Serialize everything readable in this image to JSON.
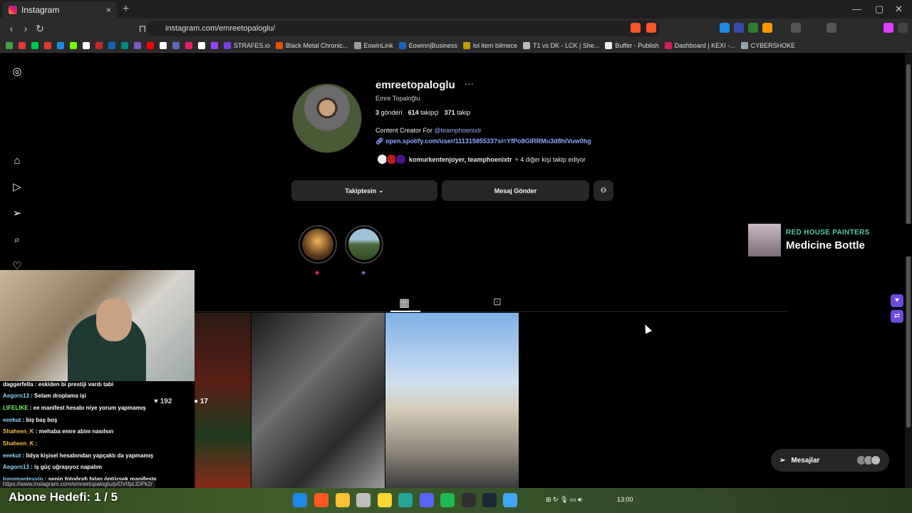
{
  "browser": {
    "tab_title": "Instagram",
    "tab_close": "×",
    "new_tab": "+",
    "url": "instagram.com/emreetopaloglu/",
    "window_controls": [
      "—",
      "▢",
      "✕"
    ],
    "nav_icons": [
      "back-icon",
      "forward-icon",
      "reload-icon"
    ],
    "bookmarks": [
      {
        "label": "STRAFES.io",
        "color": "#7b3fe4"
      },
      {
        "label": "Black Metal Chronic...",
        "color": "#e65100"
      },
      {
        "label": "EowinLink",
        "color": "#9e9e9e"
      },
      {
        "label": "Eowinn|Business",
        "color": "#1565c0"
      },
      {
        "label": "lol item bilmece",
        "color": "#c29d00"
      },
      {
        "label": "T1 vs DK - LCK | She...",
        "color": "#bbbbbb"
      },
      {
        "label": "Buffer - Publish",
        "color": "#eeeeee"
      },
      {
        "label": "Dashboard | KEXI -...",
        "color": "#d81b60"
      },
      {
        "label": "CYBERSHOKE",
        "color": "#90a4ae"
      }
    ],
    "bookmark_icons": [
      "#43a047",
      "#e53935",
      "#00c853",
      "#e53935",
      "#1e88e5",
      "#76ff03",
      "#ffffff",
      "#c62828",
      "#1565c0",
      "#00897b",
      "#7e57c2",
      "#ff0000",
      "#ffffff",
      "#5c6bc0",
      "#e91e63",
      "#ffffff",
      "#9146ff"
    ]
  },
  "sidebar": {
    "icons": [
      "instagram-logo-icon",
      "home-icon",
      "reels-icon",
      "explore-icon",
      "search-icon",
      "notifications-icon"
    ]
  },
  "profile": {
    "username": "emreetopaloglu",
    "more": "···",
    "full_name": "Emre Topaloğlu",
    "posts_count": "3",
    "posts_label": "gönderi",
    "followers_count": "614",
    "followers_label": "takipçi",
    "following_count": "371",
    "following_label": "takip",
    "bio_prefix": "Content Creator For ",
    "bio_mention": "@teamphoenixtr",
    "link": "open.spotify.com/user/11131585533?si=YfPo8GIRRMu3d8hIVuw0hg",
    "followed_by_names": "komurkentenjoyer, teamphoenixtr",
    "followed_by_suffix": " + 4 diğer kişi takip ediyor",
    "follow_button": "Takiptesin",
    "message_button": "Mesaj Gönder",
    "suggest_button_icon": "add-person-icon"
  },
  "highlights": [
    {
      "dot": "◆",
      "dot_color": "#e91e63"
    },
    {
      "dot": "◆",
      "dot_color": "#5c6bc0"
    }
  ],
  "tabs": {
    "posts_icon": "grid-icon",
    "tagged_icon": "tagged-icon"
  },
  "post_overlay": {
    "likes": "192",
    "comments": "17"
  },
  "stream": {
    "chat": [
      {
        "nick": "daggerfella",
        "nick_color": "#ffffff",
        "msg": ": eskiden bi prestiji vardı tabi"
      },
      {
        "nick": "Aegorn13",
        "nick_color": "#8fd3ff",
        "msg": ": Selam droplama işi"
      },
      {
        "nick": "LIFELIKE",
        "nick_color": "#7cff6b",
        "msg": ": ee manifest hesabı niye yorum yapmamış"
      },
      {
        "nick": "eeekut",
        "nick_color": "#8fd3ff",
        "msg": ": biş baş boş"
      },
      {
        "nick": "Shaheen_K",
        "nick_color": "#ffb74d",
        "msg": ": mehaba emre abim nasılsın"
      },
      {
        "nick": "Shaheen_K",
        "nick_color": "#ffb74d",
        "msg": ":"
      },
      {
        "nick": "eeekut",
        "nick_color": "#8fd3ff",
        "msg": ": lidya kişisel hesabından yapçaktı da yapmamış"
      },
      {
        "nick": "Aegorn13",
        "nick_color": "#8fd3ff",
        "msg": ": iş güç uğraşıyoz napalım"
      },
      {
        "nick": "longmanteyyip",
        "nick_color": "#8fd3ff",
        "msg": ": senin fotoğrafı falan öptürsek manifeste"
      }
    ],
    "goal_label": "Abone Hedefi:",
    "goal_value": "1 / 5",
    "status_url": "https://www.instagram.com/emreetopaloglu/p/DVtfpLlDPk2/"
  },
  "now_playing": {
    "artist": "RED HOUSE PAINTERS",
    "title": "Medicine Bottle"
  },
  "messages": {
    "label": "Mesajlar"
  },
  "taskbar": {
    "time": "13:00",
    "icons": [
      {
        "name": "windows-start-icon",
        "color": "#1e88e5"
      },
      {
        "name": "brave-icon",
        "color": "#ff5722"
      },
      {
        "name": "file-explorer-icon",
        "color": "#fbc02d"
      },
      {
        "name": "tool-icon",
        "color": "#bdbdbd"
      },
      {
        "name": "sticky-notes-icon",
        "color": "#fdd835"
      },
      {
        "name": "puzzle-app-icon",
        "color": "#26a69a"
      },
      {
        "name": "discord-icon",
        "color": "#5865f2"
      },
      {
        "name": "spotify-icon",
        "color": "#1db954"
      },
      {
        "name": "obs-icon",
        "color": "#303030"
      },
      {
        "name": "steam-icon",
        "color": "#1b2838"
      },
      {
        "name": "snipping-tool-icon",
        "color": "#42a5f5"
      }
    ]
  }
}
